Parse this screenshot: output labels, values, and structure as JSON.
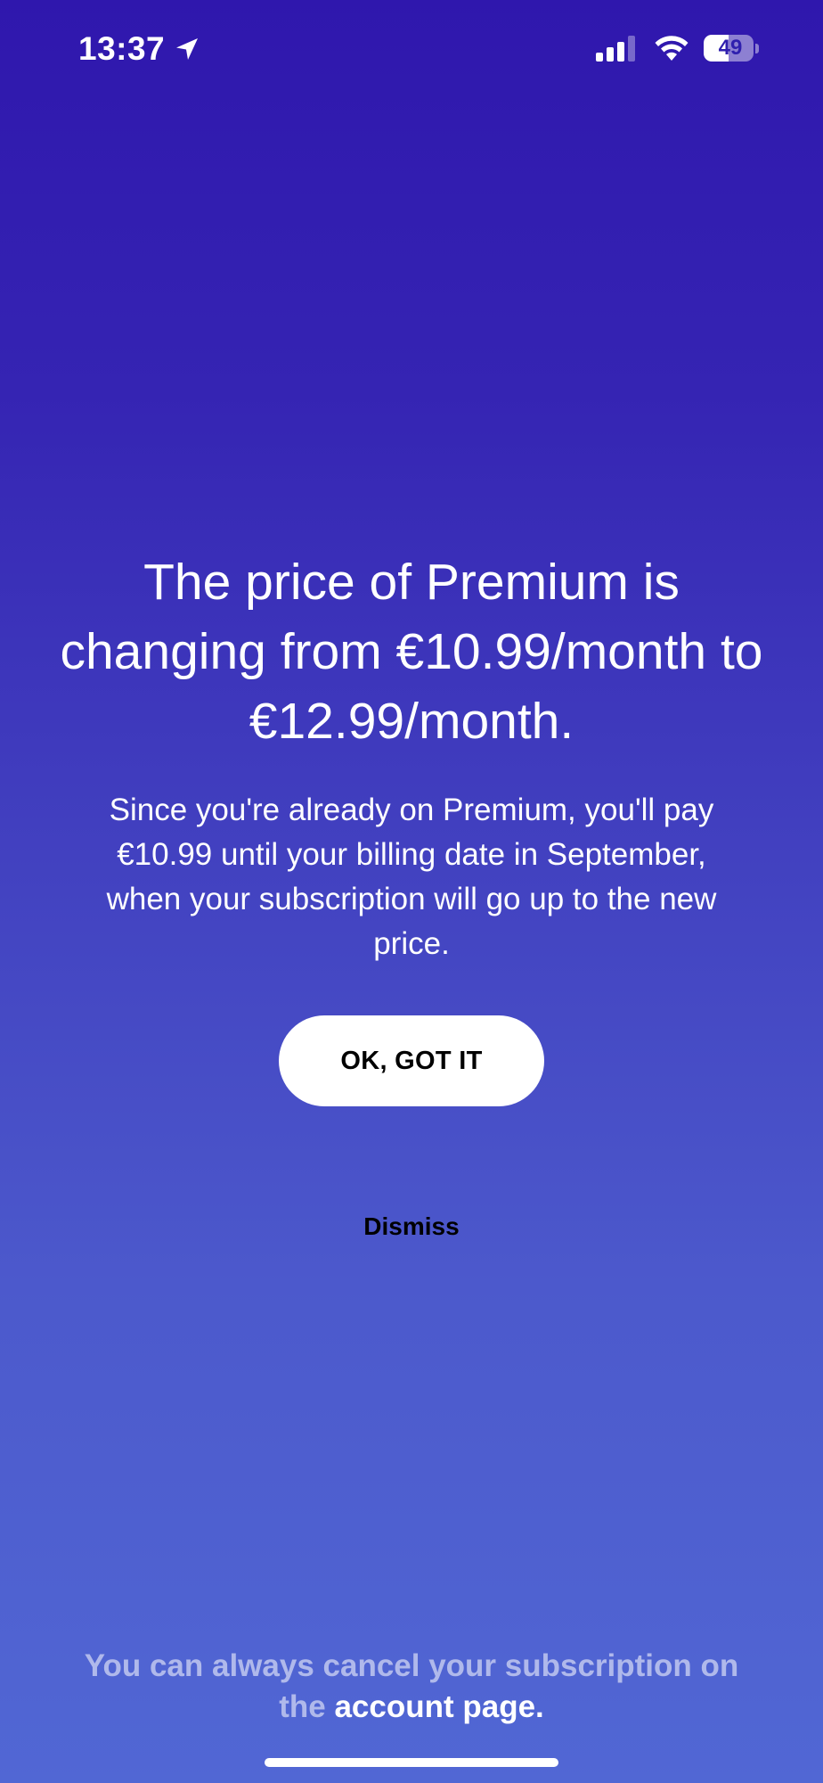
{
  "status_bar": {
    "time": "13:37",
    "battery_level": "49",
    "battery_fraction": 0.49,
    "icons": [
      "location-arrow-icon",
      "cellular-signal-icon",
      "wifi-icon",
      "battery-icon"
    ]
  },
  "dialog": {
    "headline_lines": [
      "The price of Premium is",
      "changing from €10.99/month to",
      "€12.99/month."
    ],
    "body_lines": [
      "Since you're already on Premium, you'll pay",
      "€10.99 until your billing date in September,",
      "when your subscription will go up to the new",
      "price."
    ],
    "primary_button_label": "OK, GOT IT",
    "dismiss_label": "Dismiss"
  },
  "footer": {
    "line1": "You can always cancel your subscription on",
    "line2_prefix": "the ",
    "link_text": "account page."
  },
  "colors": {
    "gradient_top": "#2f17ad",
    "gradient_bottom": "#5167d4",
    "button_background": "#ffffff",
    "button_text": "#000000"
  }
}
